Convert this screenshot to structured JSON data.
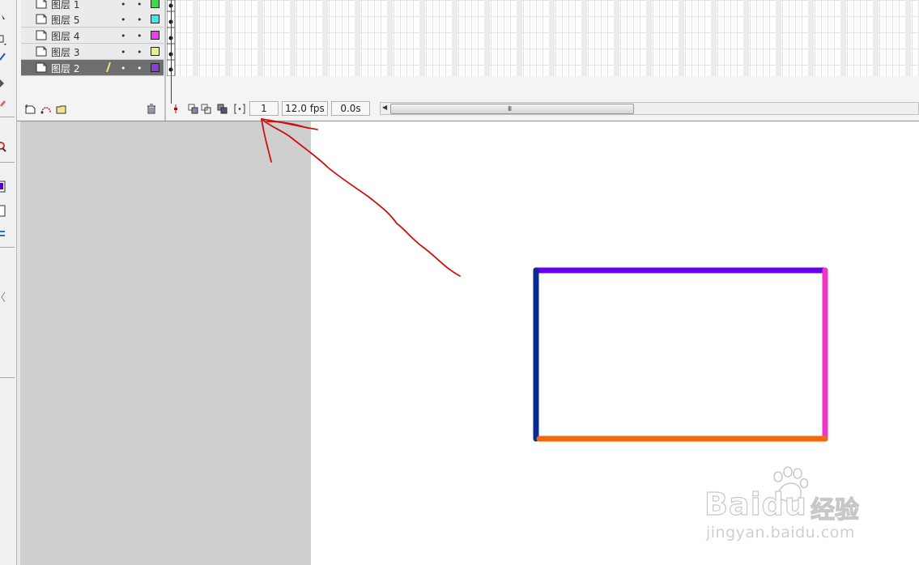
{
  "timeline": {
    "layers": [
      {
        "name": "图层 1",
        "color": "#3cdc3c",
        "active": false
      },
      {
        "name": "图层 5",
        "color": "#3ce8e8",
        "active": false
      },
      {
        "name": "图层 4",
        "color": "#f03cf0",
        "active": false
      },
      {
        "name": "图层 3",
        "color": "#f0f080",
        "active": false
      },
      {
        "name": "图层 2",
        "color": "#8c3cdc",
        "active": true
      }
    ],
    "visibility_dot": "•",
    "lock_dot": "•",
    "current_frame": "1",
    "frame_rate": "12.0 fps",
    "elapsed_time": "0.0s",
    "scroll_grip": "III",
    "scroll_arrow": "◀"
  },
  "icons": {
    "insert_layer": "insert-layer-icon",
    "add_motion_guide": "add-motion-guide-icon",
    "insert_folder": "insert-layer-folder-icon",
    "delete_layer": "trash-icon",
    "layer_type": "layer-normal-icon",
    "pencil": "pencil-icon"
  },
  "stage": {
    "rectangle_edges": {
      "top": "#6600ee",
      "left": "#0a2a90",
      "right": "#f035c8",
      "bottom": "#f2680a"
    },
    "annotation_color": "#cc1111"
  },
  "watermark": {
    "brand": "Baidu",
    "cn": "经验",
    "url": "jingyan.baidu.com"
  }
}
